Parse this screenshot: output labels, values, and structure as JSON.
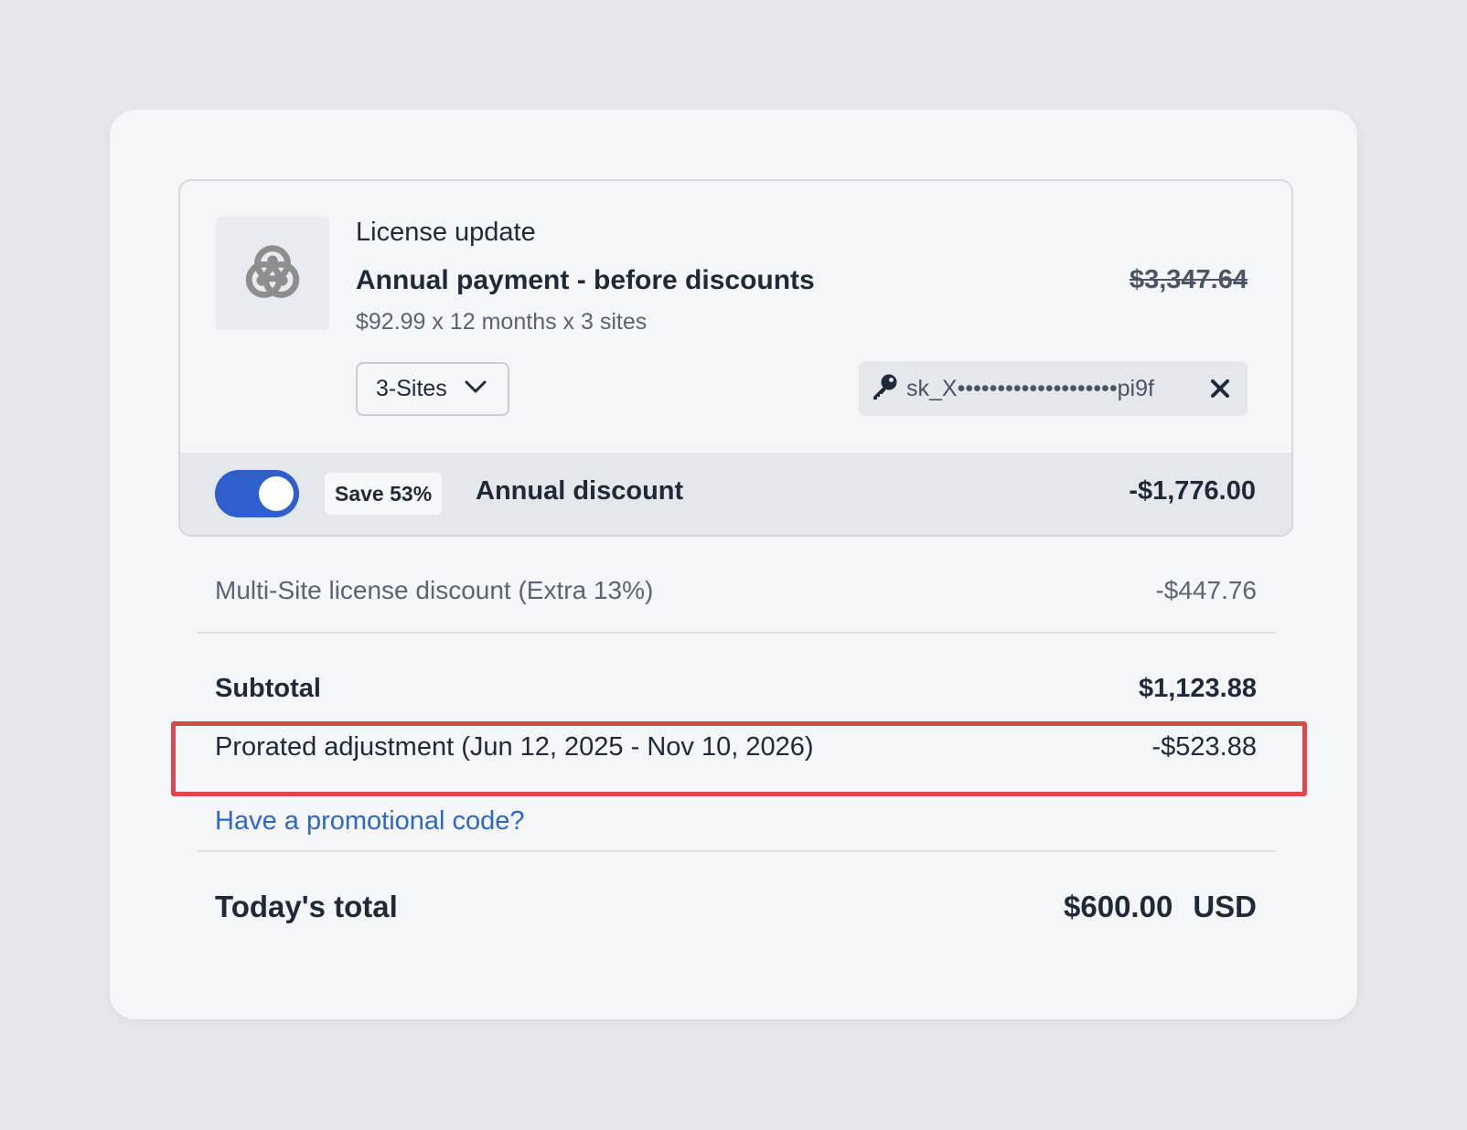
{
  "product": {
    "logo_icon": "triskelion-logo-icon",
    "eyebrow": "License update",
    "title": "Annual payment - before discounts",
    "original_price": "$3,347.64",
    "formula": "$92.99 x 12 months x 3 sites",
    "plan_select": {
      "value": "3-Sites",
      "icon": "chevron-down-icon"
    },
    "license_key": {
      "icon": "key-icon",
      "value": "sk_X••••••••••••••••••••pi9f",
      "remove_icon": "close-icon"
    }
  },
  "annual_discount": {
    "toggle_on": true,
    "badge": "Save 53%",
    "label": "Annual discount",
    "amount": "-$1,776.00"
  },
  "multisite": {
    "label": "Multi-Site license discount (Extra 13%)",
    "amount": "-$447.76"
  },
  "subtotal": {
    "label": "Subtotal",
    "amount": "$1,123.88"
  },
  "prorated": {
    "label": "Prorated adjustment (Jun 12, 2025 - Nov 10, 2026)",
    "amount": "-$523.88",
    "highlight_color": "#e0464b"
  },
  "promo": {
    "link": "Have a promotional code?"
  },
  "total": {
    "label": "Today's total",
    "amount": "$600.00",
    "currency": "USD"
  },
  "colors": {
    "accent": "#2f5fcc",
    "link": "#2f66c9",
    "highlight": "#e0464b"
  }
}
